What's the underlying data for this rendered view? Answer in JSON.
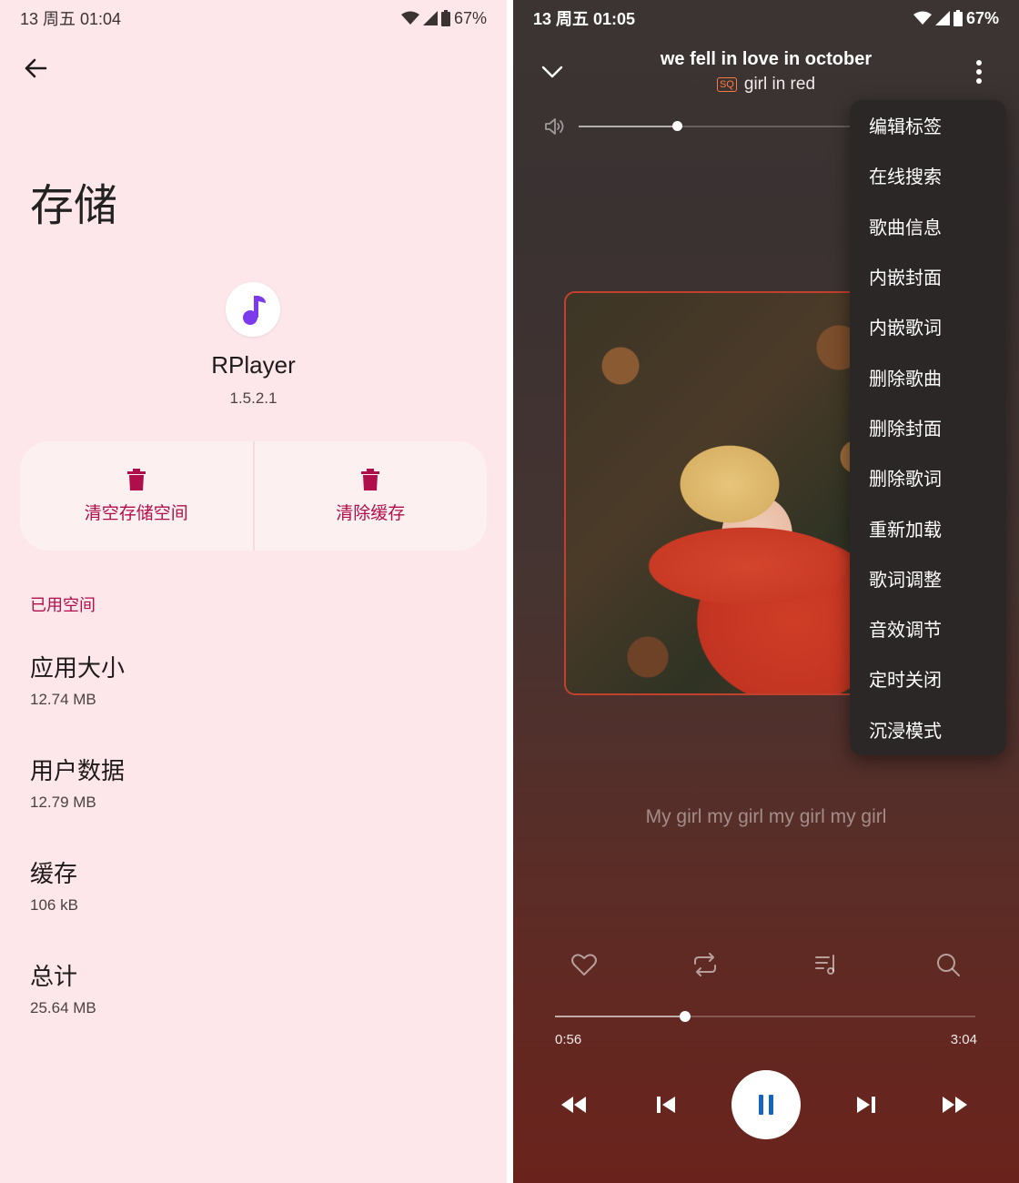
{
  "left": {
    "status": {
      "time": "13 周五 01:04",
      "battery": "67%"
    },
    "title": "存储",
    "app": {
      "name": "RPlayer",
      "version": "1.5.2.1"
    },
    "actions": {
      "clear_storage": "清空存储空间",
      "clear_cache": "清除缓存"
    },
    "section_header": "已用空间",
    "stats": [
      {
        "title": "应用大小",
        "value": "12.74 MB"
      },
      {
        "title": "用户数据",
        "value": "12.79 MB"
      },
      {
        "title": "缓存",
        "value": "106 kB"
      },
      {
        "title": "总计",
        "value": "25.64 MB"
      }
    ],
    "colors": {
      "background": "#fde7ea",
      "accent": "#b00e4a",
      "app_icon": "#7c3aed"
    }
  },
  "right": {
    "status": {
      "time": "13 周五 01:05",
      "battery": "67%"
    },
    "song": {
      "title": "we fell in love in october",
      "quality_badge": "SQ",
      "artist": "girl in red"
    },
    "volume_fraction": 0.36,
    "menu": {
      "items": [
        "编辑标签",
        "在线搜索",
        "歌曲信息",
        "内嵌封面",
        "内嵌歌词",
        "删除歌曲",
        "删除封面",
        "删除歌词",
        "重新加载",
        "歌词调整",
        "音效调节",
        "定时关闭",
        "沉浸模式"
      ]
    },
    "lyric": "My girl my girl my girl my girl",
    "progress": {
      "elapsed": "0:56",
      "duration": "3:04",
      "fraction": 0.31
    },
    "icons": [
      "heart-icon",
      "repeat-icon",
      "playlist-icon",
      "search-icon",
      "fast-rewind-icon",
      "skip-previous-icon",
      "pause-icon",
      "skip-next-icon",
      "fast-forward-icon"
    ],
    "colors": {
      "pause_icon": "#1565c0",
      "quality_badge": "#ff7a45"
    }
  }
}
